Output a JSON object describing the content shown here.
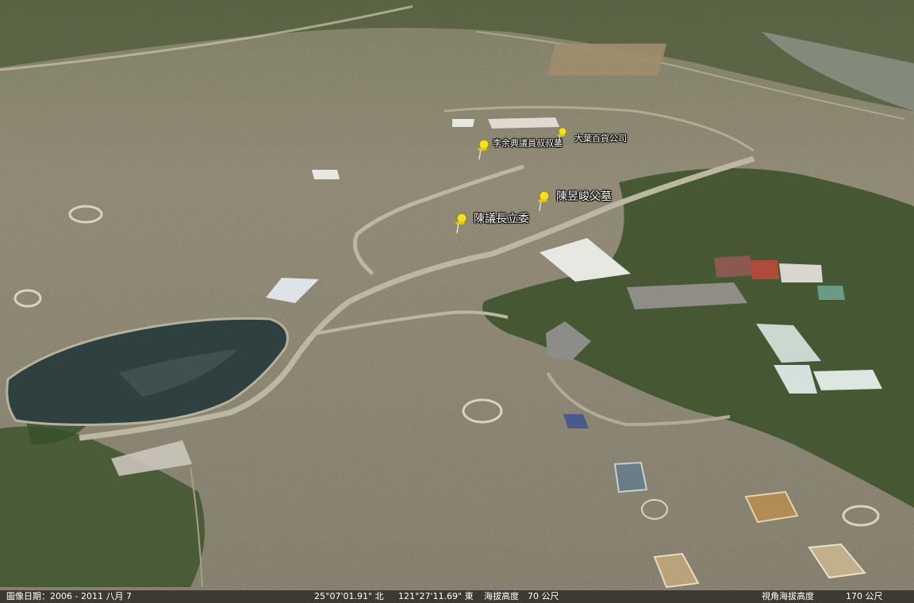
{
  "map": {
    "placemarks": [
      {
        "name": "李余典議員叔叔墓",
        "pin_color": "#f6e21a"
      },
      {
        "name": "大葉百貨公司",
        "pin_color": "#f6e21a"
      },
      {
        "name": "陳昱峻父墓",
        "pin_color": "#f6e21a"
      },
      {
        "name": "陳議長立委",
        "pin_color": "#f6e21a"
      }
    ]
  },
  "status": {
    "imagery_date": "圖像日期：2006 - 2011 八月 7",
    "latitude": "25°07'01.91\" 北",
    "longitude": "121°27'11.69\" 東",
    "elevation": "海拔高度　70 公尺",
    "eye_altitude_label": "視角海拔高度",
    "eye_altitude_value": "170 公尺"
  },
  "colors": {
    "terrain_base": "#7b7762",
    "pond": "#2f4040",
    "forest": "#2f4a22",
    "road": "#b9b3a0",
    "roof_white": "#e8e8e2"
  }
}
